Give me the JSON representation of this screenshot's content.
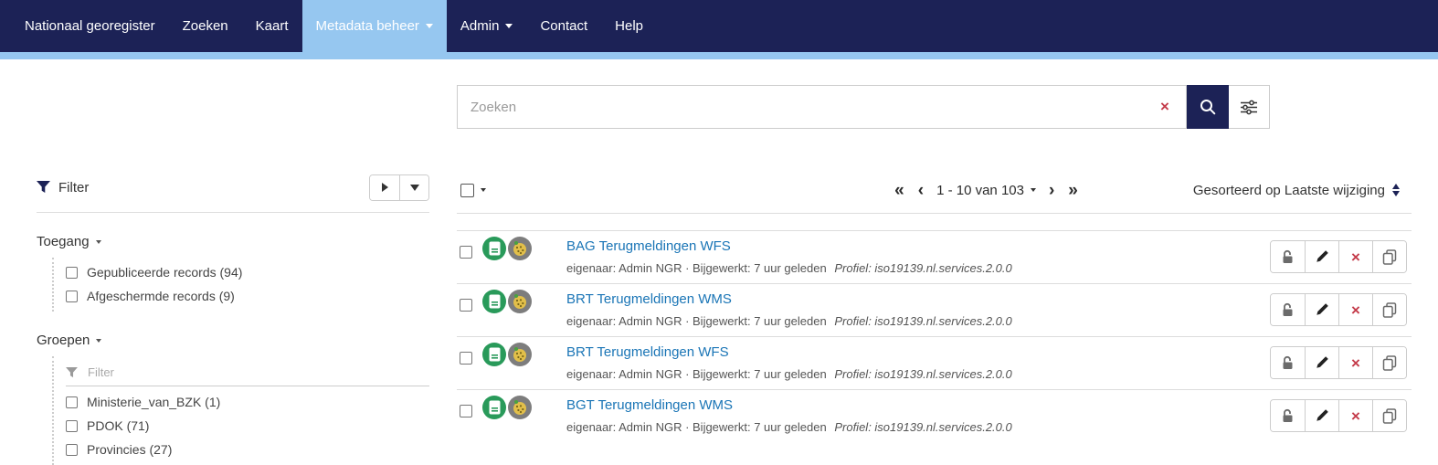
{
  "navbar": {
    "items": [
      {
        "label": "Nationaal georegister"
      },
      {
        "label": "Zoeken"
      },
      {
        "label": "Kaart"
      },
      {
        "label": "Metadata beheer"
      },
      {
        "label": "Admin"
      },
      {
        "label": "Contact"
      },
      {
        "label": "Help"
      }
    ]
  },
  "search": {
    "placeholder": "Zoeken",
    "clear_glyph": "×"
  },
  "filter_panel": {
    "title": "Filter",
    "toegang": {
      "title": "Toegang",
      "items": [
        "Gepubliceerde records (94)",
        "Afgeschermde records (9)"
      ]
    },
    "groepen": {
      "title": "Groepen",
      "filter_placeholder": "Filter",
      "items": [
        "Ministerie_van_BZK (1)",
        "PDOK (71)",
        "Provincies (27)"
      ]
    }
  },
  "list": {
    "pagination": {
      "first_glyph": "«",
      "prev_glyph": "‹",
      "range_label": "1 - 10 van 103",
      "next_glyph": "›",
      "last_glyph": "»"
    },
    "sort_label": "Gesorteerd op Laatste wijziging",
    "actions": {
      "delete_glyph": "×"
    },
    "records": [
      {
        "title": "BAG Terugmeldingen WFS",
        "meta": "eigenaar: Admin NGR · Bijgewerkt: 7 uur geleden",
        "profile": "Profiel: iso19139.nl.services.2.0.0"
      },
      {
        "title": "BRT Terugmeldingen WMS",
        "meta": "eigenaar: Admin NGR · Bijgewerkt: 7 uur geleden",
        "profile": "Profiel: iso19139.nl.services.2.0.0"
      },
      {
        "title": "BRT Terugmeldingen WFS",
        "meta": "eigenaar: Admin NGR · Bijgewerkt: 7 uur geleden",
        "profile": "Profiel: iso19139.nl.services.2.0.0"
      },
      {
        "title": "BGT Terugmeldingen WMS",
        "meta": "eigenaar: Admin NGR · Bijgewerkt: 7 uur geleden",
        "profile": "Profiel: iso19139.nl.services.2.0.0"
      }
    ]
  },
  "colors": {
    "navbar_bg": "#1c2256",
    "accent_blue": "#96c7f0",
    "link_blue": "#1a75b6",
    "record_green": "#299a5a",
    "danger_red": "#c43b4a"
  }
}
